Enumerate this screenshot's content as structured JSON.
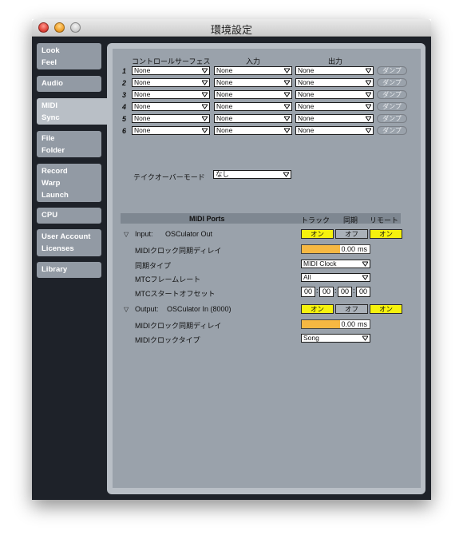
{
  "window": {
    "title": "環境設定"
  },
  "sidebar": {
    "tabs": [
      {
        "line1": "Look",
        "line2": "Feel"
      },
      {
        "line1": "Audio",
        "line2": ""
      },
      {
        "line1": "MIDI",
        "line2": "Sync"
      },
      {
        "line1": "File",
        "line2": "Folder"
      },
      {
        "line1": "Record",
        "line2": "Warp",
        "line3": "Launch"
      },
      {
        "line1": "CPU",
        "line2": ""
      },
      {
        "line1": "User Account",
        "line2": "Licenses"
      },
      {
        "line1": "Library",
        "line2": ""
      }
    ]
  },
  "surfaces": {
    "headers": {
      "control": "コントロールサーフェス",
      "input": "入力",
      "output": "出力"
    },
    "rows": [
      {
        "num": "1",
        "control": "None",
        "input": "None",
        "output": "None",
        "dump": "ダンプ"
      },
      {
        "num": "2",
        "control": "None",
        "input": "None",
        "output": "None",
        "dump": "ダンプ"
      },
      {
        "num": "3",
        "control": "None",
        "input": "None",
        "output": "None",
        "dump": "ダンプ"
      },
      {
        "num": "4",
        "control": "None",
        "input": "None",
        "output": "None",
        "dump": "ダンプ"
      },
      {
        "num": "5",
        "control": "None",
        "input": "None",
        "output": "None",
        "dump": "ダンプ"
      },
      {
        "num": "6",
        "control": "None",
        "input": "None",
        "output": "None",
        "dump": "ダンプ"
      }
    ]
  },
  "takeover": {
    "label": "テイクオーバーモード",
    "value": "なし"
  },
  "ports": {
    "header": {
      "title": "MIDI Ports",
      "track": "トラック",
      "sync": "同期",
      "remote": "リモート"
    },
    "input": {
      "label": "Input:",
      "name": "OSCulator Out",
      "track": "オン",
      "sync": "オフ",
      "remote": "オン",
      "delay_label": "MIDIクロック同期ディレイ",
      "delay_value": "0.00",
      "delay_unit": "ms",
      "type_label": "同期タイプ",
      "type_value": "MIDI Clock",
      "framerate_label": "MTCフレームレート",
      "framerate_value": "All",
      "offset_label": "MTCスタートオフセット",
      "offset": [
        "00",
        "00",
        "00",
        "00"
      ]
    },
    "output": {
      "label": "Output:",
      "name": "OSCulator In (8000)",
      "track": "オン",
      "sync": "オフ",
      "remote": "オン",
      "delay_label": "MIDIクロック同期ディレイ",
      "delay_value": "0.00",
      "delay_unit": "ms",
      "clocktype_label": "MIDIクロックタイプ",
      "clocktype_value": "Song"
    }
  },
  "colors": {
    "on": "#f6f20d",
    "off": "#aab1b9",
    "value_fill": "#f6b842",
    "panel": "#9aa2ab",
    "sidebar": "#1e2229"
  }
}
